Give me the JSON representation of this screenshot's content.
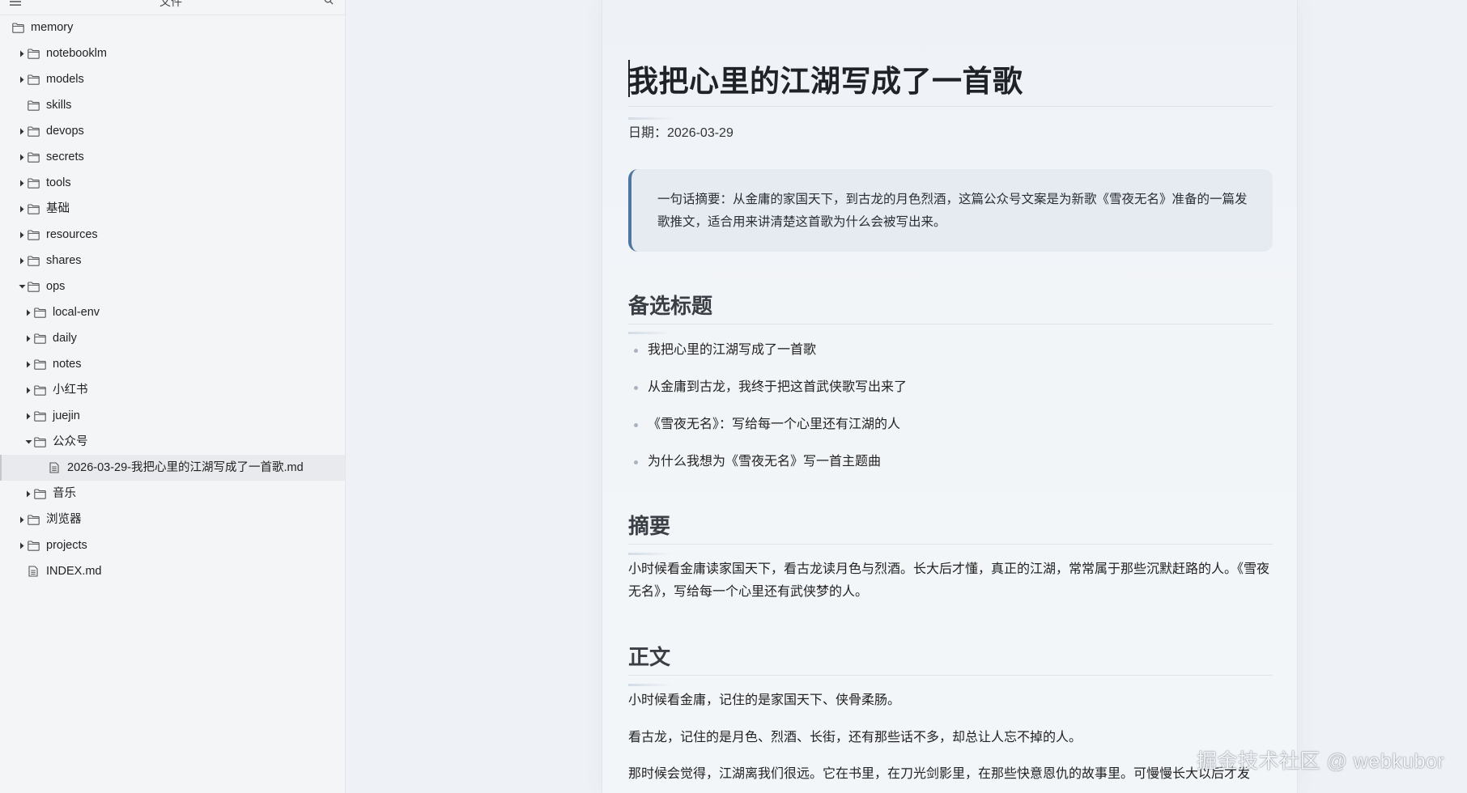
{
  "sidebar": {
    "title": "文件",
    "tree": [
      {
        "label": "memory",
        "type": "folder",
        "caret": "none",
        "level": 0
      },
      {
        "label": "notebooklm",
        "type": "folder",
        "caret": "right",
        "level": 1
      },
      {
        "label": "models",
        "type": "folder",
        "caret": "right",
        "level": 1
      },
      {
        "label": "skills",
        "type": "folder",
        "caret": "none",
        "level": 1
      },
      {
        "label": "devops",
        "type": "folder",
        "caret": "right",
        "level": 1
      },
      {
        "label": "secrets",
        "type": "folder",
        "caret": "right",
        "level": 1
      },
      {
        "label": "tools",
        "type": "folder",
        "caret": "right",
        "level": 1
      },
      {
        "label": "基础",
        "type": "folder",
        "caret": "right",
        "level": 1
      },
      {
        "label": "resources",
        "type": "folder",
        "caret": "right",
        "level": 1
      },
      {
        "label": "shares",
        "type": "folder",
        "caret": "right",
        "level": 1
      },
      {
        "label": "ops",
        "type": "folder",
        "caret": "down",
        "level": 1
      },
      {
        "label": "local-env",
        "type": "folder",
        "caret": "right",
        "level": 2
      },
      {
        "label": "daily",
        "type": "folder",
        "caret": "right",
        "level": 2
      },
      {
        "label": "notes",
        "type": "folder",
        "caret": "right",
        "level": 2
      },
      {
        "label": "小红书",
        "type": "folder",
        "caret": "right",
        "level": 2
      },
      {
        "label": "juejin",
        "type": "folder",
        "caret": "right",
        "level": 2
      },
      {
        "label": "公众号",
        "type": "folder",
        "caret": "down",
        "level": 2
      },
      {
        "label": "2026-03-29-我把心里的江湖写成了一首歌.md",
        "type": "file",
        "caret": "none",
        "level": 3,
        "active": true
      },
      {
        "label": "音乐",
        "type": "folder",
        "caret": "right",
        "level": 2
      },
      {
        "label": "浏览器",
        "type": "folder",
        "caret": "right",
        "level": 1
      },
      {
        "label": "projects",
        "type": "folder",
        "caret": "right",
        "level": 1
      },
      {
        "label": "INDEX.md",
        "type": "file",
        "caret": "none",
        "level": 1
      }
    ]
  },
  "document": {
    "title": "我把心里的江湖写成了一首歌",
    "date": "日期：2026-03-29",
    "summary_quote": "一句话摘要：从金庸的家国天下，到古龙的月色烈酒，这篇公众号文案是为新歌《雪夜无名》准备的一篇发歌推文，适合用来讲清楚这首歌为什么会被写出来。",
    "section_alt_titles": "备选标题",
    "alt_titles": [
      "我把心里的江湖写成了一首歌",
      "从金庸到古龙，我终于把这首武侠歌写出来了",
      "《雪夜无名》：写给每一个心里还有江湖的人",
      "为什么我想为《雪夜无名》写一首主题曲"
    ],
    "section_summary": "摘要",
    "summary_text": "小时候看金庸读家国天下，看古龙读月色与烈酒。长大后才懂，真正的江湖，常常属于那些沉默赶路的人。《雪夜无名》，写给每一个心里还有武侠梦的人。",
    "section_body": "正文",
    "body_p1": "小时候看金庸，记住的是家国天下、侠骨柔肠。",
    "body_p2": "看古龙，记住的是月色、烈酒、长街，还有那些话不多，却总让人忘不掉的人。",
    "body_p3": "那时候会觉得，江湖离我们很远。它在书里，在刀光剑影里，在那些快意恩仇的故事里。可慢慢长大以后才发"
  },
  "watermark": "掘金技术社区 @ webkubor",
  "icons": {
    "menu": "menu-icon",
    "search": "search-icon",
    "folder": "folder-icon",
    "file": "file-icon"
  }
}
